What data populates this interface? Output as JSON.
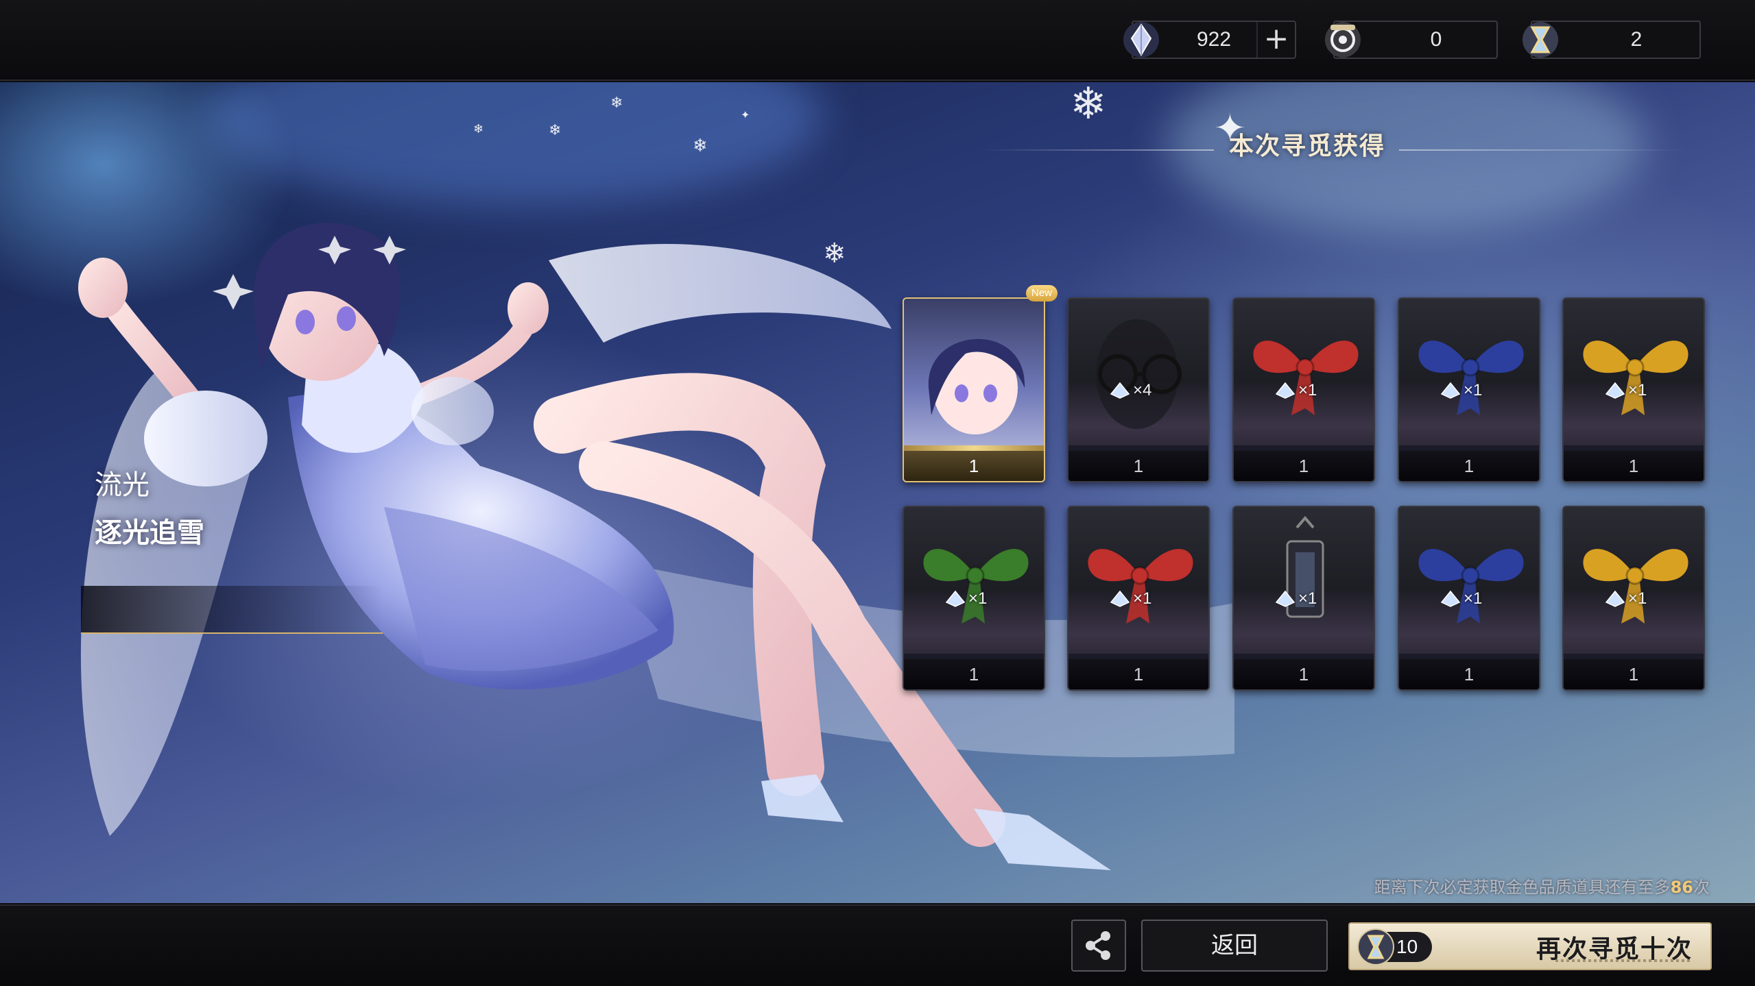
{
  "currencies": [
    {
      "name": "crystal",
      "value": "922",
      "has_plus": true
    },
    {
      "name": "compass-ticket",
      "value": "0",
      "has_plus": false
    },
    {
      "name": "hourglass-ticket",
      "value": "2",
      "has_plus": false
    }
  ],
  "character": {
    "line1": "流光",
    "line2": "逐光追雪"
  },
  "results": {
    "title": "本次寻觅获得",
    "new_badge": "New",
    "items": [
      {
        "kind": "portrait",
        "qty": "",
        "count": "1",
        "gold": true
      },
      {
        "kind": "glasses",
        "qty": "×4",
        "count": "1",
        "color": "#222222"
      },
      {
        "kind": "bow",
        "qty": "×1",
        "count": "1",
        "color": "#c0302c"
      },
      {
        "kind": "bow",
        "qty": "×1",
        "count": "1",
        "color": "#2c3f9e"
      },
      {
        "kind": "bow",
        "qty": "×1",
        "count": "1",
        "color": "#d9a122"
      },
      {
        "kind": "bow",
        "qty": "×1",
        "count": "1",
        "color": "#3a7d2a"
      },
      {
        "kind": "bow",
        "qty": "×1",
        "count": "1",
        "color": "#c0302c"
      },
      {
        "kind": "lantern",
        "qty": "×1",
        "count": "1",
        "color": "#2a2a36"
      },
      {
        "kind": "bow",
        "qty": "×1",
        "count": "1",
        "color": "#2c3f9e"
      },
      {
        "kind": "bow",
        "qty": "×1",
        "count": "1",
        "color": "#d9a122"
      }
    ]
  },
  "pity": {
    "prefix": "距离下次必定获取金色品质道具还有至多",
    "number": "86",
    "suffix": "次"
  },
  "buttons": {
    "back": "返回",
    "again_cost": "10",
    "again_label": "再次寻觅十次"
  },
  "colors": {
    "gold_accent": "#e2c278",
    "pity_highlight": "#f2c97a"
  }
}
